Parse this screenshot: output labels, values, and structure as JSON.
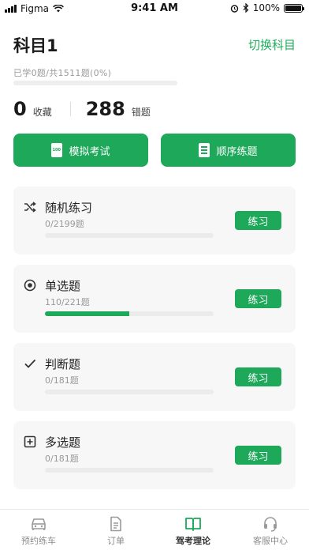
{
  "status_bar": {
    "carrier": "Figma",
    "time": "9:41 AM",
    "battery": "100%"
  },
  "header": {
    "title": "科目1",
    "switch_label": "切换科目",
    "progress_text": "已学0题/共1511题(0%)",
    "progress_fraction": 0
  },
  "stats": {
    "favorites_count": "0",
    "favorites_label": "收藏",
    "mistakes_count": "288",
    "mistakes_label": "错题"
  },
  "actions": {
    "mock_exam_label": "模拟考试",
    "sequential_label": "顺序练题"
  },
  "cards": [
    {
      "title": "随机练习",
      "count": "0/2199题",
      "button": "练习",
      "progress_fraction": 0,
      "icon": "shuffle-icon"
    },
    {
      "title": "单选题",
      "count": "110/221题",
      "button": "练习",
      "progress_fraction": 0.5,
      "icon": "radio-icon"
    },
    {
      "title": "判断题",
      "count": "0/181题",
      "button": "练习",
      "progress_fraction": 0,
      "icon": "check-icon"
    },
    {
      "title": "多选题",
      "count": "0/181题",
      "button": "练习",
      "progress_fraction": 0,
      "icon": "plus-box-icon"
    }
  ],
  "tabs": [
    {
      "label": "预约练车",
      "icon": "car-icon",
      "active": false
    },
    {
      "label": "订单",
      "icon": "document-icon",
      "active": false
    },
    {
      "label": "驾考理论",
      "icon": "book-icon",
      "active": true
    },
    {
      "label": "客服中心",
      "icon": "headset-icon",
      "active": false
    }
  ],
  "colors": {
    "accent": "#1ea85a",
    "card_bg": "#f7f7f7",
    "inactive_tab": "#8c8c8c"
  }
}
